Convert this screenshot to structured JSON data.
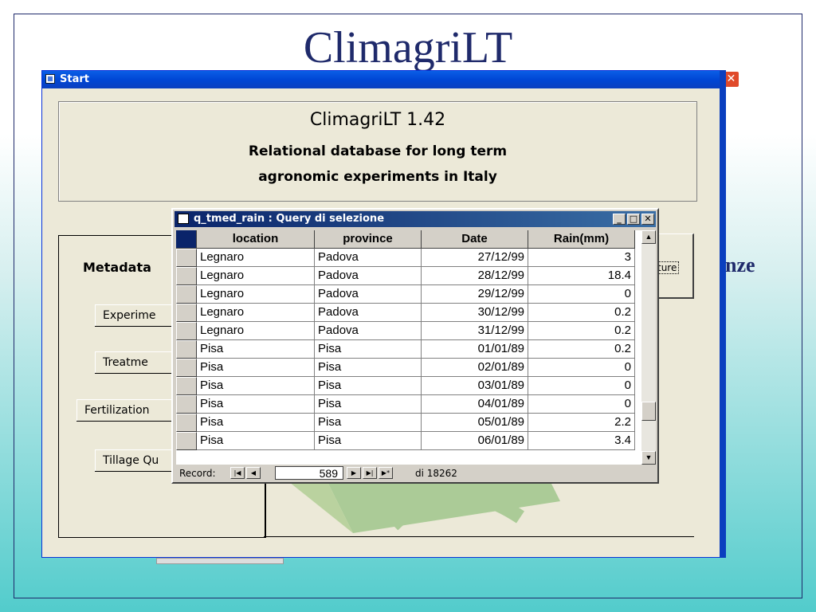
{
  "slide": {
    "title": "ClimagriLT",
    "fragment_right": "nze"
  },
  "start_window": {
    "title": "Start",
    "info": {
      "app_version": "ClimagriLT 1.42",
      "line2": "Relational database for long term",
      "line3": "agronomic experiments in Italy"
    },
    "metadata_title": "Metadata",
    "buttons": [
      "Experime",
      "Treatme",
      "Fertilization",
      "Tillage Qu"
    ],
    "structure_button": "ture"
  },
  "query_window": {
    "title": "q_tmed_rain : Query di selezione",
    "columns": [
      "location",
      "province",
      "Date",
      "Rain(mm)"
    ],
    "rows": [
      [
        "Legnaro",
        "Padova",
        "27/12/99",
        "3"
      ],
      [
        "Legnaro",
        "Padova",
        "28/12/99",
        "18.4"
      ],
      [
        "Legnaro",
        "Padova",
        "29/12/99",
        "0"
      ],
      [
        "Legnaro",
        "Padova",
        "30/12/99",
        "0.2"
      ],
      [
        "Legnaro",
        "Padova",
        "31/12/99",
        "0.2"
      ],
      [
        "Pisa",
        "Pisa",
        "01/01/89",
        "0.2"
      ],
      [
        "Pisa",
        "Pisa",
        "02/01/89",
        "0"
      ],
      [
        "Pisa",
        "Pisa",
        "03/01/89",
        "0"
      ],
      [
        "Pisa",
        "Pisa",
        "04/01/89",
        "0"
      ],
      [
        "Pisa",
        "Pisa",
        "05/01/89",
        "2.2"
      ],
      [
        "Pisa",
        "Pisa",
        "06/01/89",
        "3.4"
      ]
    ],
    "record_label": "Record:",
    "record_number": "589",
    "record_total": "di 18262"
  },
  "colors": {
    "xp_blue": "#0046d5",
    "access_title": "#0a246a",
    "slide_title": "#1f2a6b"
  }
}
